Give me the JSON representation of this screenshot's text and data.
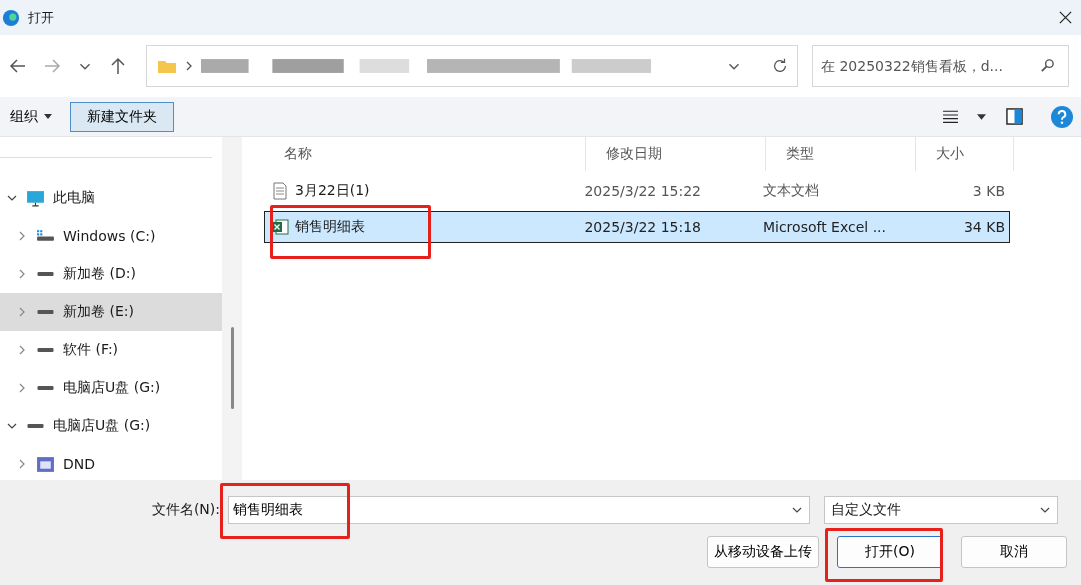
{
  "window": {
    "title": "打开"
  },
  "search": {
    "placeholder": "在 20250322销售看板，d..."
  },
  "toolbar": {
    "organize": "组织",
    "new_folder": "新建文件夹"
  },
  "sidebar": {
    "items": [
      {
        "label": "此电脑",
        "kind": "pc",
        "expanded": true,
        "selected": false,
        "children": [
          {
            "label": "Windows (C:)",
            "kind": "sysdrive",
            "expanded": false,
            "selected": false
          },
          {
            "label": "新加卷 (D:)",
            "kind": "drive",
            "expanded": false,
            "selected": false
          },
          {
            "label": "新加卷 (E:)",
            "kind": "drive",
            "expanded": false,
            "selected": true
          },
          {
            "label": "软件 (F:)",
            "kind": "drive",
            "expanded": false,
            "selected": false
          },
          {
            "label": "电脑店U盘 (G:)",
            "kind": "drive",
            "expanded": false,
            "selected": false
          }
        ]
      },
      {
        "label": "电脑店U盘 (G:)",
        "kind": "drive",
        "expanded": true,
        "selected": false,
        "children": [
          {
            "label": "DND",
            "kind": "folder",
            "expanded": false,
            "selected": false
          }
        ]
      }
    ]
  },
  "table": {
    "columns": [
      "名称",
      "修改日期",
      "类型",
      "大小"
    ],
    "rows": [
      {
        "name": "3月22日(1)",
        "kind": "text",
        "date": "2025/3/22 15:22",
        "type": "文本文档",
        "size": "3 KB",
        "selected": false,
        "highlighted": false
      },
      {
        "name": "销售明细表",
        "kind": "excel",
        "date": "2025/3/22 15:18",
        "type": "Microsoft Excel ...",
        "size": "34 KB",
        "selected": true,
        "highlighted": true
      }
    ]
  },
  "footer": {
    "filename_label": "文件名(N):",
    "filename": "销售明细表",
    "filename_highlighted": true,
    "filter": "自定义文件",
    "buttons": [
      {
        "label": "从移动设备上传",
        "kind": "plain",
        "highlighted": false
      },
      {
        "label": "打开(O)",
        "kind": "primary",
        "highlighted": true
      },
      {
        "label": "取消",
        "kind": "plain",
        "highlighted": false
      }
    ]
  }
}
